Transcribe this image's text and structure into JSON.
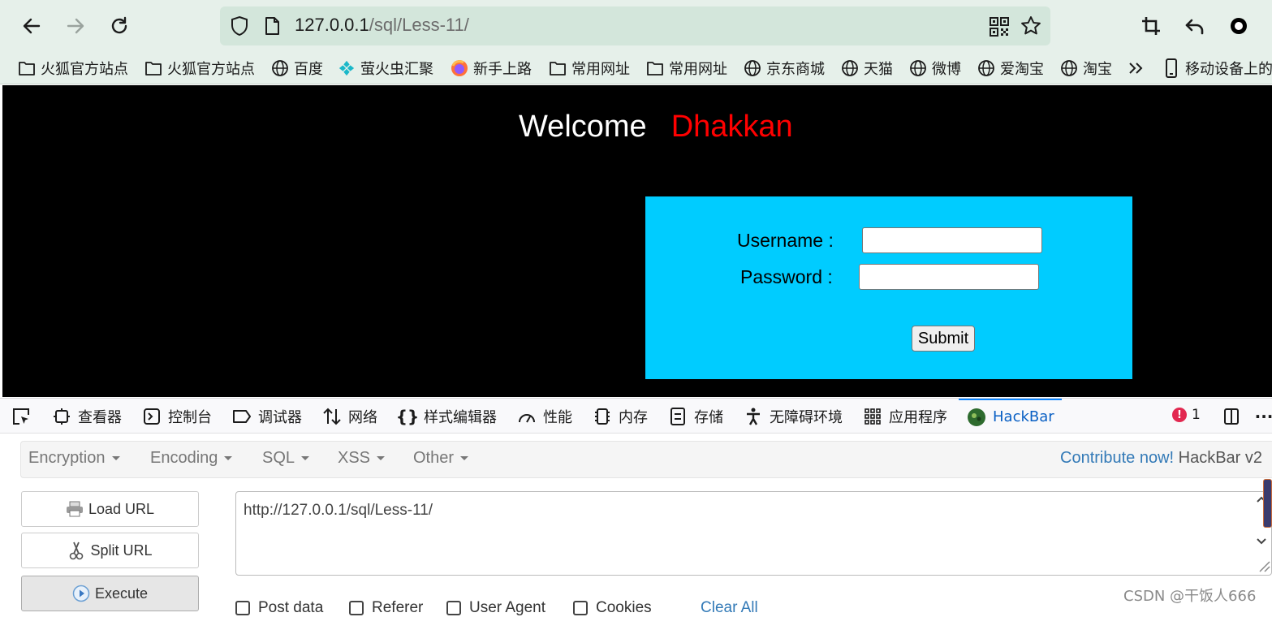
{
  "browser": {
    "url_host": "127.0.0.1",
    "url_path": "/sql/Less-11/"
  },
  "bookmarks": [
    {
      "label": "火狐官方站点",
      "icon": "folder-icon"
    },
    {
      "label": "火狐官方站点",
      "icon": "folder-icon"
    },
    {
      "label": "百度",
      "icon": "globe-icon"
    },
    {
      "label": "萤火虫汇聚",
      "icon": "firefly-icon"
    },
    {
      "label": "新手上路",
      "icon": "firefox-icon"
    },
    {
      "label": "常用网址",
      "icon": "folder-icon"
    },
    {
      "label": "常用网址",
      "icon": "folder-icon"
    },
    {
      "label": "京东商城",
      "icon": "globe-icon"
    },
    {
      "label": "天猫",
      "icon": "globe-icon"
    },
    {
      "label": "微博",
      "icon": "globe-icon"
    },
    {
      "label": "爱淘宝",
      "icon": "globe-icon"
    },
    {
      "label": "淘宝",
      "icon": "globe-icon"
    },
    {
      "label": "移动设备上的书",
      "icon": "mobile-icon"
    }
  ],
  "page": {
    "welcome": "Welcome",
    "name": "Dhakkan",
    "username_label": "Username :",
    "password_label": "Password :",
    "submit_label": "Submit"
  },
  "devtools": {
    "tabs": [
      "查看器",
      "控制台",
      "调试器",
      "网络",
      "样式编辑器",
      "性能",
      "内存",
      "存储",
      "无障碍环境",
      "应用程序",
      "HackBar"
    ],
    "active_tab": "HackBar",
    "error_count": "1",
    "error_badge": "!"
  },
  "hackbar": {
    "menus": [
      "Encryption",
      "Encoding",
      "SQL",
      "XSS",
      "Other"
    ],
    "contribute": "Contribute now!",
    "version": "HackBar v2",
    "load_url": "Load URL",
    "split_url": "Split URL",
    "execute": "Execute",
    "url_value": "http://127.0.0.1/sql/Less-11/",
    "checkboxes": [
      "Post data",
      "Referer",
      "User Agent",
      "Cookies"
    ],
    "clear_all": "Clear All"
  },
  "watermark": "CSDN @干饭人666",
  "colors": {
    "page_bg": "#000000",
    "login_box": "#00ccff",
    "name_color": "#ff0000",
    "link_color": "#337ab7"
  }
}
